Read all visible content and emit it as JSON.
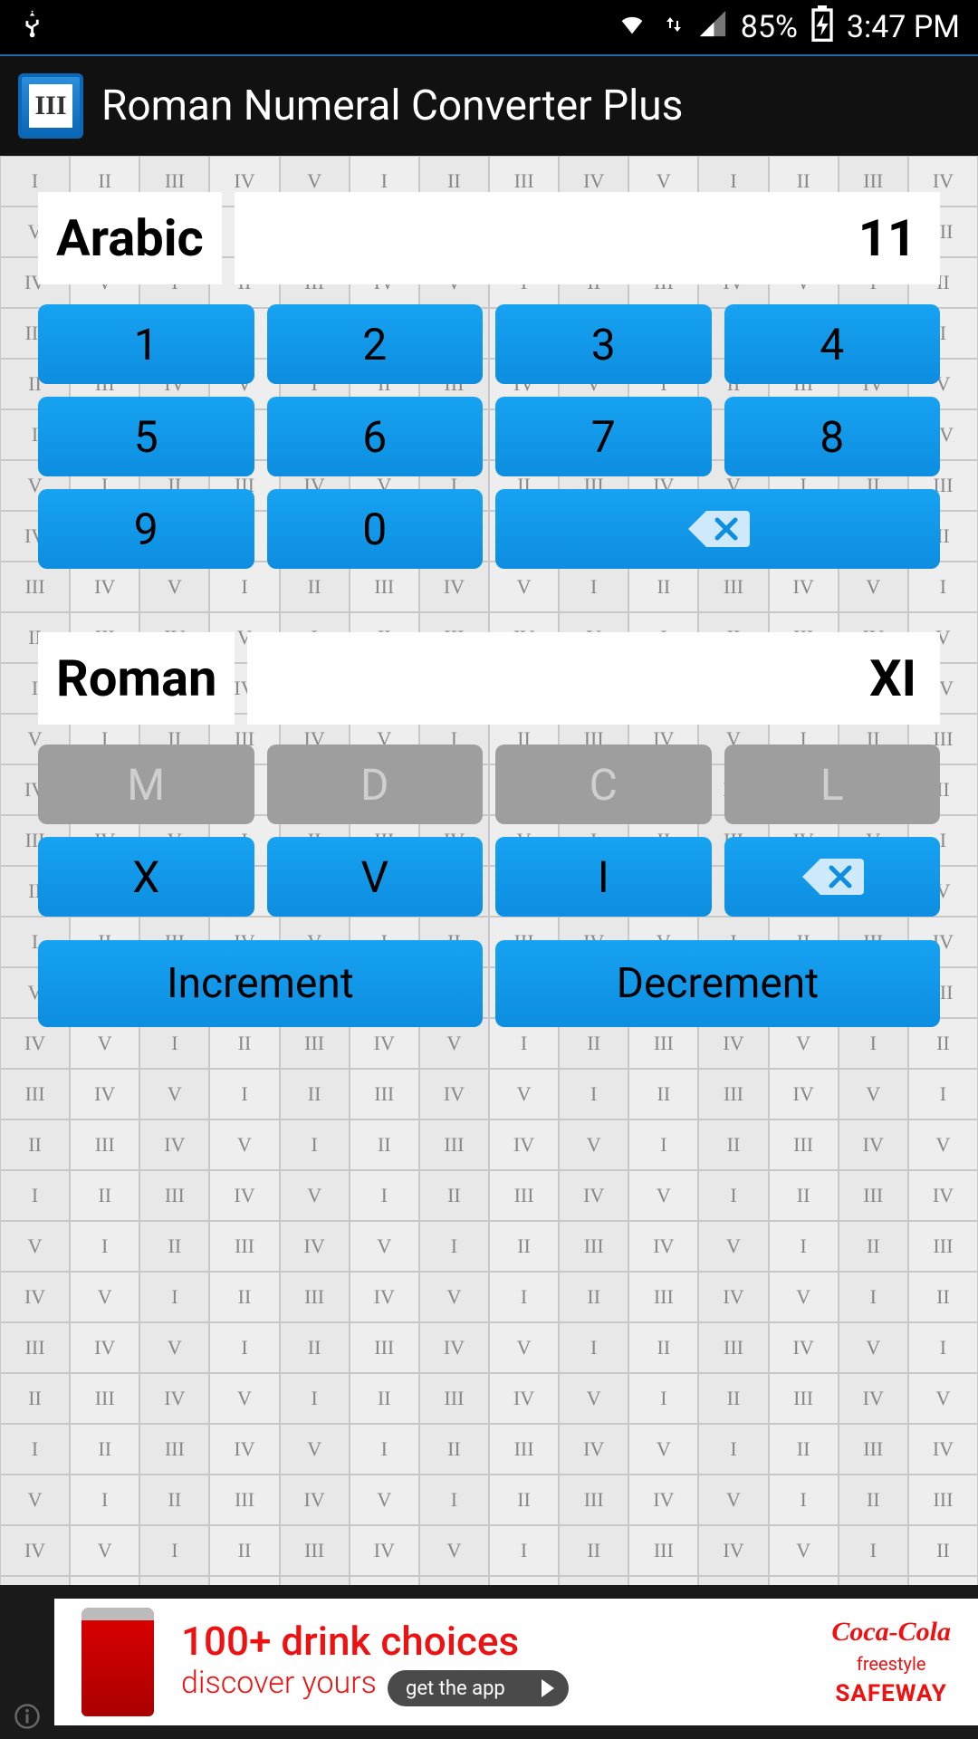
{
  "status": {
    "battery_pct": "85%",
    "time": "3:47 PM"
  },
  "header": {
    "title": "Roman Numeral Converter Plus"
  },
  "arabic": {
    "label": "Arabic",
    "value": "11",
    "keys": [
      "1",
      "2",
      "3",
      "4",
      "5",
      "6",
      "7",
      "8",
      "9",
      "0"
    ]
  },
  "roman": {
    "label": "Roman",
    "value": "XI",
    "keys_disabled": [
      "M",
      "D",
      "C",
      "L"
    ],
    "keys_enabled": [
      "X",
      "V",
      "I"
    ]
  },
  "actions": {
    "increment": "Increment",
    "decrement": "Decrement"
  },
  "ad": {
    "line1": "100+ drink choices",
    "line2": "discover yours",
    "cta": "get the app",
    "brand1": "Coca-Cola",
    "brand2": "freestyle",
    "brand3": "SAFEWAY"
  }
}
